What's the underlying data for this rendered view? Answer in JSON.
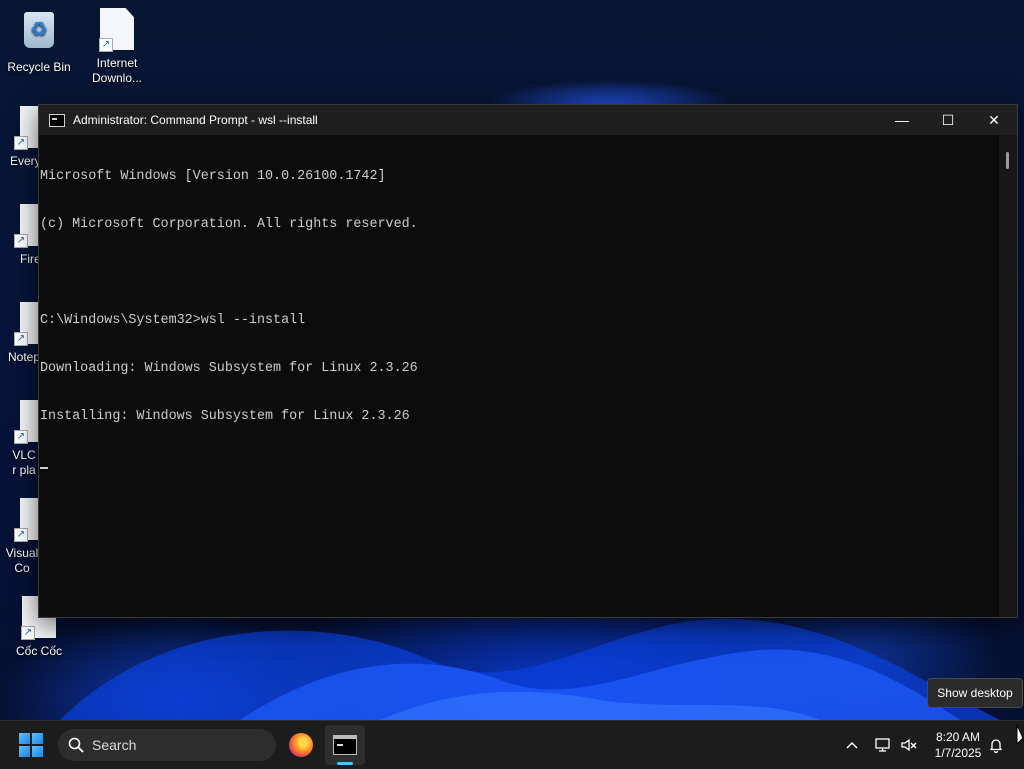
{
  "desktop": {
    "icons": [
      {
        "label": "Recycle Bin"
      },
      {
        "label": "Internet Downlo..."
      },
      {
        "label": "Every"
      },
      {
        "label": "Fire"
      },
      {
        "label": "Notep"
      },
      {
        "label": "VLC r pla"
      },
      {
        "label": "Visual Co"
      },
      {
        "label": "Cốc Cốc"
      }
    ]
  },
  "window": {
    "title": "Administrator: Command Prompt - wsl  --install",
    "minimize_glyph": "—",
    "maximize_glyph": "☐",
    "close_glyph": "✕",
    "console_lines": [
      "Microsoft Windows [Version 10.0.26100.1742]",
      "(c) Microsoft Corporation. All rights reserved.",
      "",
      "C:\\Windows\\System32>wsl --install",
      "Downloading: Windows Subsystem for Linux 2.3.26",
      "Installing: Windows Subsystem for Linux 2.3.26"
    ]
  },
  "tooltip": {
    "text": "Show desktop"
  },
  "taskbar": {
    "search_placeholder": "Search",
    "apps": [
      {
        "name": "Firefox",
        "icon": "firefox-icon",
        "active": false
      },
      {
        "name": "Command Prompt",
        "icon": "command-prompt-icon",
        "active": true
      }
    ],
    "tray": {
      "chevron": "^",
      "time": "8:20 AM",
      "date": "1/7/2025"
    }
  },
  "colors": {
    "console_bg": "#0c0c0c",
    "console_text": "#cccccc",
    "taskbar_bg": "#1c1c1c",
    "accent": "#4cc2ff"
  }
}
